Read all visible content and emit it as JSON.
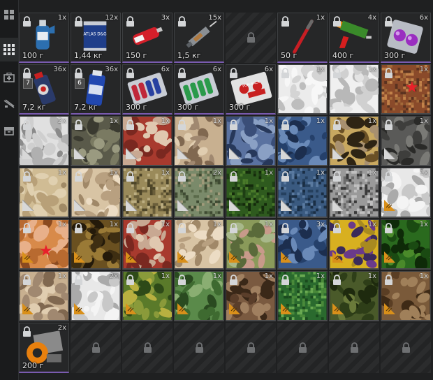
{
  "sidebar": {
    "items": [
      {
        "name": "all-items-icon",
        "active": false
      },
      {
        "name": "grid-view-icon",
        "active": true
      },
      {
        "name": "medkit-icon",
        "active": false
      },
      {
        "name": "weapon-icon",
        "active": false
      },
      {
        "name": "container-icon",
        "active": false
      }
    ]
  },
  "colors": {
    "background": "#1f2021",
    "cell": "#262728",
    "fold_orange": "#d9901a",
    "star_red": "#e8202a"
  },
  "rows": [
    [
      {
        "kind": "item",
        "item": "blue-bottle",
        "qty": "1x",
        "weight": "100 г"
      },
      {
        "kind": "item",
        "item": "atlas-can",
        "qty": "12x",
        "weight": "1,44 кг",
        "label": "ATLAS D&G"
      },
      {
        "kind": "item",
        "item": "injector-red",
        "qty": "3x",
        "weight": "150 г"
      },
      {
        "kind": "item",
        "item": "syringe",
        "qty": "15x",
        "weight": "1,5 кг"
      },
      {
        "kind": "empty"
      },
      {
        "kind": "item",
        "item": "red-stick",
        "qty": "1x",
        "weight": "50 г"
      },
      {
        "kind": "item",
        "item": "caulk-gun",
        "qty": "4x",
        "weight": "400 г"
      },
      {
        "kind": "item",
        "item": "purple-balls",
        "qty": "6x",
        "weight": "300 г"
      }
    ],
    [
      {
        "kind": "item",
        "item": "spray-can-7",
        "qty": "36x",
        "weight": "7,2 кг",
        "level": "7"
      },
      {
        "kind": "item",
        "item": "spray-can-6",
        "qty": "36x",
        "weight": "7,2 кг",
        "level": "6"
      },
      {
        "kind": "item",
        "item": "blister-red",
        "qty": "6x",
        "weight": "300 г"
      },
      {
        "kind": "item",
        "item": "blister-green",
        "qty": "6x",
        "weight": "300 г"
      },
      {
        "kind": "item",
        "item": "pom-pack",
        "qty": "6x",
        "weight": "300 г",
        "label": "POM-BACK"
      },
      {
        "kind": "camo",
        "pattern": "snow",
        "qty": "1x"
      },
      {
        "kind": "camo",
        "pattern": "winter",
        "qty": "1x"
      },
      {
        "kind": "camo",
        "pattern": "flora-star",
        "qty": "1x",
        "star": true
      }
    ],
    [
      {
        "kind": "camo",
        "pattern": "snow-grey",
        "qty": "2x",
        "fold": "grey"
      },
      {
        "kind": "camo",
        "pattern": "forest-dark",
        "qty": "1x",
        "fold": "grey"
      },
      {
        "kind": "camo",
        "pattern": "red-camo",
        "qty": "1x",
        "fold": "grey"
      },
      {
        "kind": "camo",
        "pattern": "desert-beige",
        "qty": "1x",
        "fold": "grey"
      },
      {
        "kind": "camo",
        "pattern": "blue-grey",
        "qty": "1x",
        "fold": "grey"
      },
      {
        "kind": "camo",
        "pattern": "navy-blue",
        "qty": "1x",
        "fold": "grey"
      },
      {
        "kind": "camo",
        "pattern": "tan-woodland",
        "qty": "1x",
        "fold": "grey"
      },
      {
        "kind": "camo",
        "pattern": "urban-dark",
        "qty": "1x",
        "fold": "grey"
      }
    ],
    [
      {
        "kind": "camo",
        "pattern": "sand",
        "qty": "1x",
        "fold": "grey"
      },
      {
        "kind": "camo",
        "pattern": "tan-light",
        "qty": "1x",
        "fold": "grey"
      },
      {
        "kind": "camo",
        "pattern": "digital-olive",
        "qty": "1x",
        "fold": "grey"
      },
      {
        "kind": "camo",
        "pattern": "digital-mix",
        "qty": "2x",
        "fold": "grey"
      },
      {
        "kind": "camo",
        "pattern": "green-digital",
        "qty": "1x",
        "fold": "grey"
      },
      {
        "kind": "camo",
        "pattern": "blue-digital",
        "qty": "1x",
        "fold": "grey"
      },
      {
        "kind": "camo",
        "pattern": "grey-digital",
        "qty": "1x",
        "fold": "grey"
      },
      {
        "kind": "camo",
        "pattern": "white-grey",
        "qty": "1x",
        "fold": "orange"
      }
    ],
    [
      {
        "kind": "camo",
        "pattern": "orange-star",
        "qty": "1x",
        "fold": "orange",
        "star": true
      },
      {
        "kind": "camo",
        "pattern": "dark-brown",
        "qty": "1x",
        "fold": "orange"
      },
      {
        "kind": "camo",
        "pattern": "red-camo",
        "qty": "1x",
        "fold": "orange"
      },
      {
        "kind": "camo",
        "pattern": "tan-light",
        "qty": "1x",
        "fold": "orange"
      },
      {
        "kind": "camo",
        "pattern": "olive-pink",
        "qty": "1x",
        "fold": "orange"
      },
      {
        "kind": "camo",
        "pattern": "navy-blue",
        "qty": "3x",
        "fold": "orange"
      },
      {
        "kind": "camo",
        "pattern": "yellow-purple",
        "qty": "1x",
        "fold": "orange"
      },
      {
        "kind": "camo",
        "pattern": "green-leaf",
        "qty": "1x",
        "fold": "orange"
      }
    ],
    [
      {
        "kind": "camo",
        "pattern": "desert-beige",
        "qty": "1x",
        "fold": "orange"
      },
      {
        "kind": "camo",
        "pattern": "white-grey",
        "qty": "2x",
        "fold": "orange"
      },
      {
        "kind": "camo",
        "pattern": "green-yellow",
        "qty": "1x",
        "fold": "orange"
      },
      {
        "kind": "camo",
        "pattern": "green-woodland",
        "qty": "1x",
        "fold": "orange"
      },
      {
        "kind": "camo",
        "pattern": "brown-woodland",
        "qty": "1x",
        "fold": "orange"
      },
      {
        "kind": "camo",
        "pattern": "green-pixel",
        "qty": "1x",
        "fold": "orange"
      },
      {
        "kind": "camo",
        "pattern": "olive-green",
        "qty": "1x",
        "fold": "orange"
      },
      {
        "kind": "camo",
        "pattern": "brown-tan",
        "qty": "1x",
        "fold": "orange"
      }
    ],
    [
      {
        "kind": "item",
        "item": "duct-tape",
        "qty": "2x",
        "weight": "200 г"
      },
      {
        "kind": "empty"
      },
      {
        "kind": "empty"
      },
      {
        "kind": "empty"
      },
      {
        "kind": "empty"
      },
      {
        "kind": "empty"
      },
      {
        "kind": "empty"
      },
      {
        "kind": "empty"
      }
    ]
  ]
}
